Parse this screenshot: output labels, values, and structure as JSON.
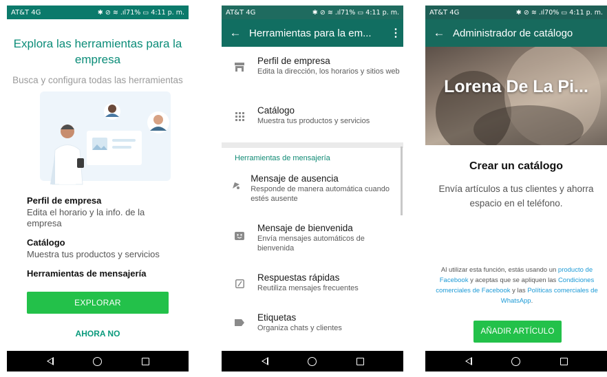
{
  "status_bar": {
    "carrier": "AT&T 4G",
    "p1_right": "✱ ⊘ ≋ .ıl71% ▭ 4:11 p. m.",
    "p2_right": "✱ ⊘ ≋ .ıl71% ▭ 4:11 p. m.",
    "p3_right": "✱ ⊘ ≋ .ıl70% ▭ 4:11 p. m."
  },
  "screen1": {
    "title": "Explora las herramientas para la empresa",
    "subtitle": "Busca y configura todas las herramientas",
    "features": [
      {
        "heading": "Perfil de empresa",
        "description": "Edita el horario y la info. de la empresa"
      },
      {
        "heading": "Catálogo",
        "description": "Muestra tus productos y servicios"
      },
      {
        "heading": "Herramientas de mensajería",
        "description": ""
      }
    ],
    "explore_button": "EXPLORAR",
    "not_now_button": "AHORA NO"
  },
  "screen2": {
    "appbar_title": "Herramientas para la em...",
    "items_top": [
      {
        "title": "Perfil de empresa",
        "description": "Edita la dirección, los horarios y sitios web",
        "icon": "store-icon"
      },
      {
        "title": "Catálogo",
        "description": "Muestra tus productos y servicios",
        "icon": "grid-icon"
      }
    ],
    "section_label": "Herramientas de mensajería",
    "items_messaging": [
      {
        "title": "Mensaje de ausencia",
        "description": "Responde de manera automática cuando estés ausente",
        "icon": "away-icon"
      },
      {
        "title": "Mensaje de bienvenida",
        "description": "Envía mensajes automáticos de bienvenida",
        "icon": "welcome-icon"
      },
      {
        "title": "Respuestas rápidas",
        "description": "Reutiliza mensajes frecuentes",
        "icon": "quick-reply-icon"
      },
      {
        "title": "Etiquetas",
        "description": "Organiza chats y clientes",
        "icon": "label-icon"
      }
    ]
  },
  "screen3": {
    "appbar_title": "Administrador de catálogo",
    "hero_name": "Lorena De La Pi...",
    "heading": "Crear un catálogo",
    "description": "Envía artículos a tus clientes y ahorra espacio en el teléfono.",
    "legal": {
      "t1": "Al utilizar esta función, estás usando un ",
      "l1": "producto de Facebook",
      "t2": " y aceptas que se apliquen las ",
      "l2": "Condiciones comerciales de Facebook",
      "t3": " y las ",
      "l3": "Políticas comerciales de WhatsApp",
      "t4": "."
    },
    "add_button": "AÑADIR ARTÍCULO"
  },
  "colors": {
    "whatsapp_green": "#23c14a",
    "teal_dark": "#116e61",
    "teal_text": "#0b8c78",
    "link_blue": "#1c9ad6"
  }
}
